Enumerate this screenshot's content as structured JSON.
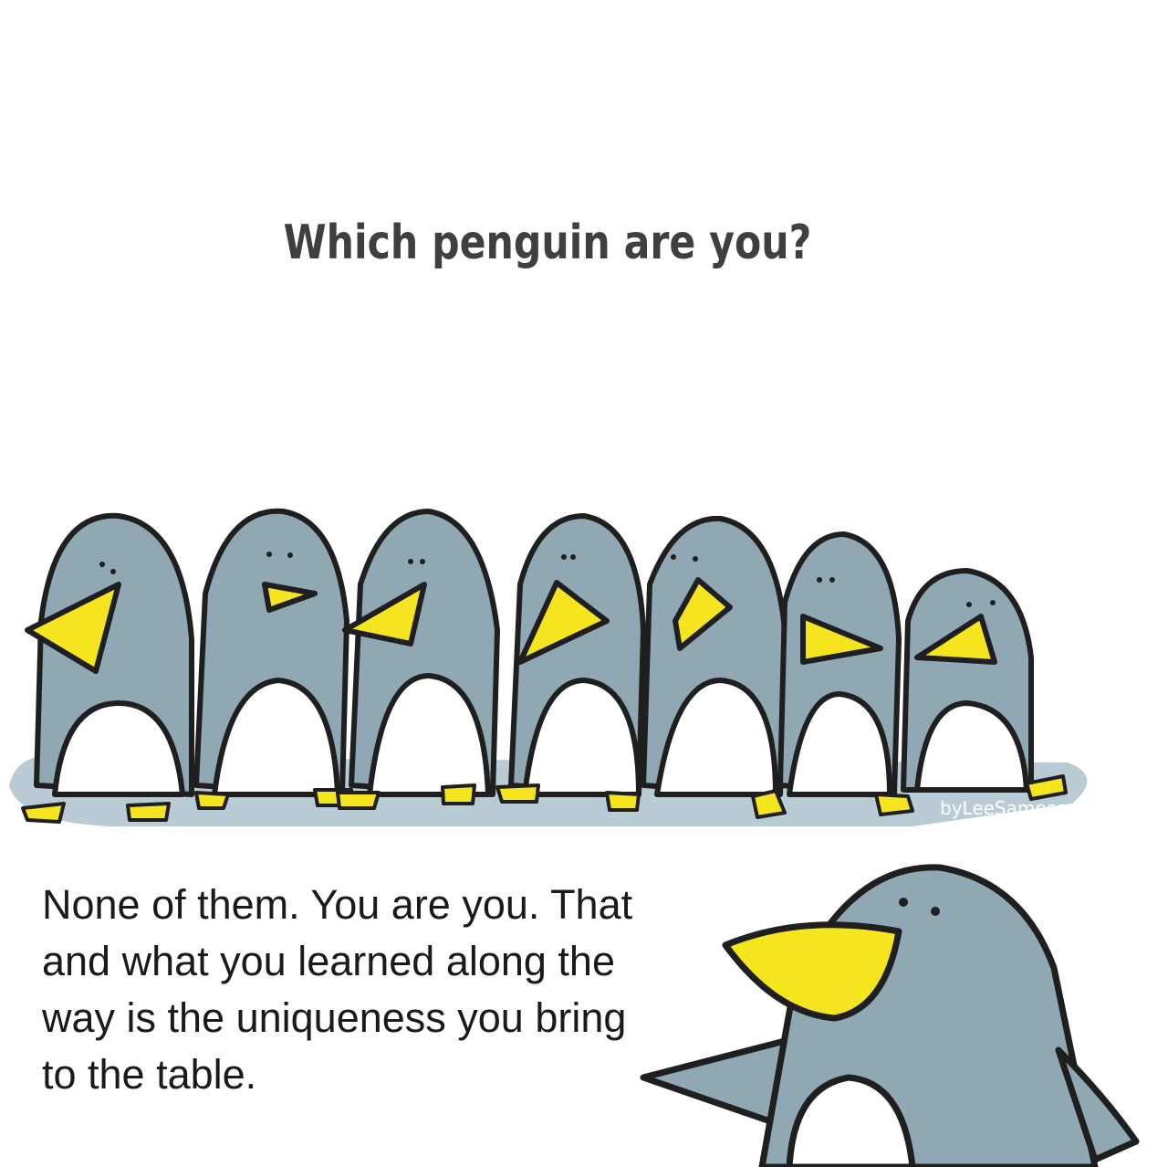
{
  "title": "Which penguin are you?",
  "caption": [
    "None of them. You are you. That",
    "and what you learned along the",
    "way is the uniqueness you bring",
    "to the table."
  ],
  "signature": "byLeeSampson",
  "colors": {
    "penguin_body": "#8fa8b4",
    "penguin_shade": "#6f8c99",
    "beak": "#f5e51e",
    "outline": "#1f1f1f",
    "shadow": "#b9cbd4",
    "title": "#3f3f3f"
  }
}
